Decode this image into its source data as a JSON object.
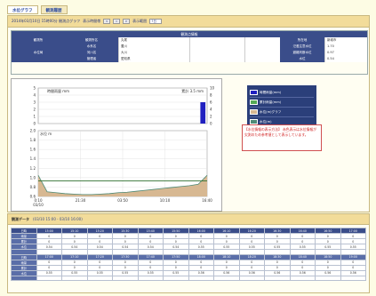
{
  "tabs": [
    {
      "label": "水位グラフ",
      "active": true
    },
    {
      "label": "観測履歴",
      "active": false
    }
  ],
  "titlebar": {
    "datetime": "2014年03月10日 15時00分 観測点グラフ",
    "range_label": "表示時間帯",
    "nav_buttons": [
      "<",
      "=",
      ">"
    ],
    "period_label": "表示範囲",
    "period_value": "7日"
  },
  "info": {
    "header": "観測点情報",
    "rows": [
      [
        "観測所",
        "観測所名",
        "丸尾",
        "",
        "",
        "所在地",
        "新城市"
      ],
      [
        "",
        "水系名",
        "豊川",
        "",
        "",
        "氾濫注意水位",
        "1.70"
      ],
      [
        "水位局",
        "河川名",
        "大川",
        "",
        "",
        "避難判断水位",
        "0.97"
      ],
      [
        "",
        "管理者",
        "愛知県",
        "",
        "",
        "水位",
        "0.54"
      ]
    ]
  },
  "chart": {
    "rain_title": "時間雨量 mm",
    "rain_total_label": "累計 3.5 mm",
    "level_title": "水位 m",
    "rain_y_ticks": [
      "5",
      "4",
      "3",
      "2",
      "1",
      "0"
    ],
    "rain_y2_ticks": [
      "10",
      "8",
      "6",
      "4",
      "2",
      "0"
    ],
    "level_y_ticks": [
      "2.0",
      "1.8",
      "1.6",
      "1.4",
      "1.2",
      "1.0",
      "0.8",
      "0.6"
    ],
    "x_ticks": [
      "0:10",
      "21:30",
      "03:50",
      "10:10",
      "16:40"
    ],
    "x_date": "03/10",
    "colors": {
      "rain": "#2020c0",
      "level_fill": "#d7b892",
      "level_line": "#4e8a76",
      "grid": "#dddddd"
    }
  },
  "chart_data": {
    "type": "area",
    "rain": [
      0,
      0,
      0,
      0,
      0,
      0,
      0,
      0,
      0,
      0,
      0,
      0,
      0,
      0,
      0,
      0,
      0,
      0,
      0,
      3
    ],
    "level": [
      1.05,
      0.7,
      0.68,
      0.66,
      0.65,
      0.64,
      0.64,
      0.65,
      0.66,
      0.68,
      0.69,
      0.71,
      0.73,
      0.75,
      0.77,
      0.79,
      0.81,
      0.83,
      0.86,
      1.05
    ],
    "level_threshold": 0.93,
    "rain_ylim": [
      0,
      5
    ],
    "level_ylim": [
      0.6,
      2.0
    ]
  },
  "legend": {
    "items": [
      {
        "label": "時間雨量(mm)",
        "color": "#2020c0"
      },
      {
        "label": "累計雨量(mm)",
        "color": "#55aa55"
      },
      {
        "label": "水位(m)グラフ",
        "color": "#d7b892"
      },
      {
        "label": "水位(m)",
        "color": "#4e8a76"
      },
      {
        "label": "避難判断水位(m)",
        "color": "#ffffff"
      }
    ],
    "footer": "0.97 m"
  },
  "note": {
    "text": "【水位情報の表示方法】 赤色表示は水位情報が欠測のため参考値として表示しています。"
  },
  "obs": {
    "title": "観測データ",
    "range": "(03/10 15:00 - 03/10 16:00)",
    "headers": [
      "日時",
      "15:00",
      "15:10",
      "15:20",
      "15:30",
      "15:40",
      "15:50",
      "16:00",
      "16:10",
      "16:20",
      "16:30",
      "16:40",
      "16:50",
      "17:00"
    ],
    "rows": [
      [
        "雨量",
        "0",
        "0",
        "0",
        "0",
        "0",
        "0",
        "0",
        "0",
        "0",
        "0",
        "0",
        "0",
        "0"
      ],
      [
        "累計",
        "0",
        "0",
        "0",
        "0",
        "0",
        "0",
        "0",
        "0",
        "0",
        "0",
        "0",
        "0",
        "0"
      ],
      [
        "水位",
        "0.54",
        "0.54",
        "0.54",
        "0.54",
        "0.54",
        "0.54",
        "0.55",
        "0.55",
        "0.55",
        "0.55",
        "0.55",
        "0.55",
        "0.55"
      ],
      [
        "",
        "",
        "",
        "",
        "",
        "",
        "",
        "",
        "",
        "",
        "",
        "",
        "",
        ""
      ],
      [
        "日時",
        "17:00",
        "17:10",
        "17:20",
        "17:30",
        "17:40",
        "17:50",
        "18:00",
        "18:10",
        "18:20",
        "18:30",
        "18:40",
        "18:50",
        "19:00"
      ],
      [
        "雨量",
        "0",
        "0",
        "0",
        "0",
        "0",
        "0",
        "0",
        "0",
        "0",
        "0",
        "0",
        "0",
        "0"
      ],
      [
        "累計",
        "0",
        "0",
        "0",
        "0",
        "0",
        "0",
        "0",
        "0",
        "0",
        "0",
        "0",
        "0",
        "0"
      ],
      [
        "水位",
        "0.55",
        "0.55",
        "0.55",
        "0.55",
        "0.55",
        "0.55",
        "0.56",
        "0.56",
        "0.56",
        "0.56",
        "0.56",
        "0.56",
        "0.56"
      ],
      [
        "",
        "",
        "",
        "",
        "",
        "",
        "",
        "",
        "",
        "",
        "",
        "",
        "",
        ""
      ]
    ]
  }
}
